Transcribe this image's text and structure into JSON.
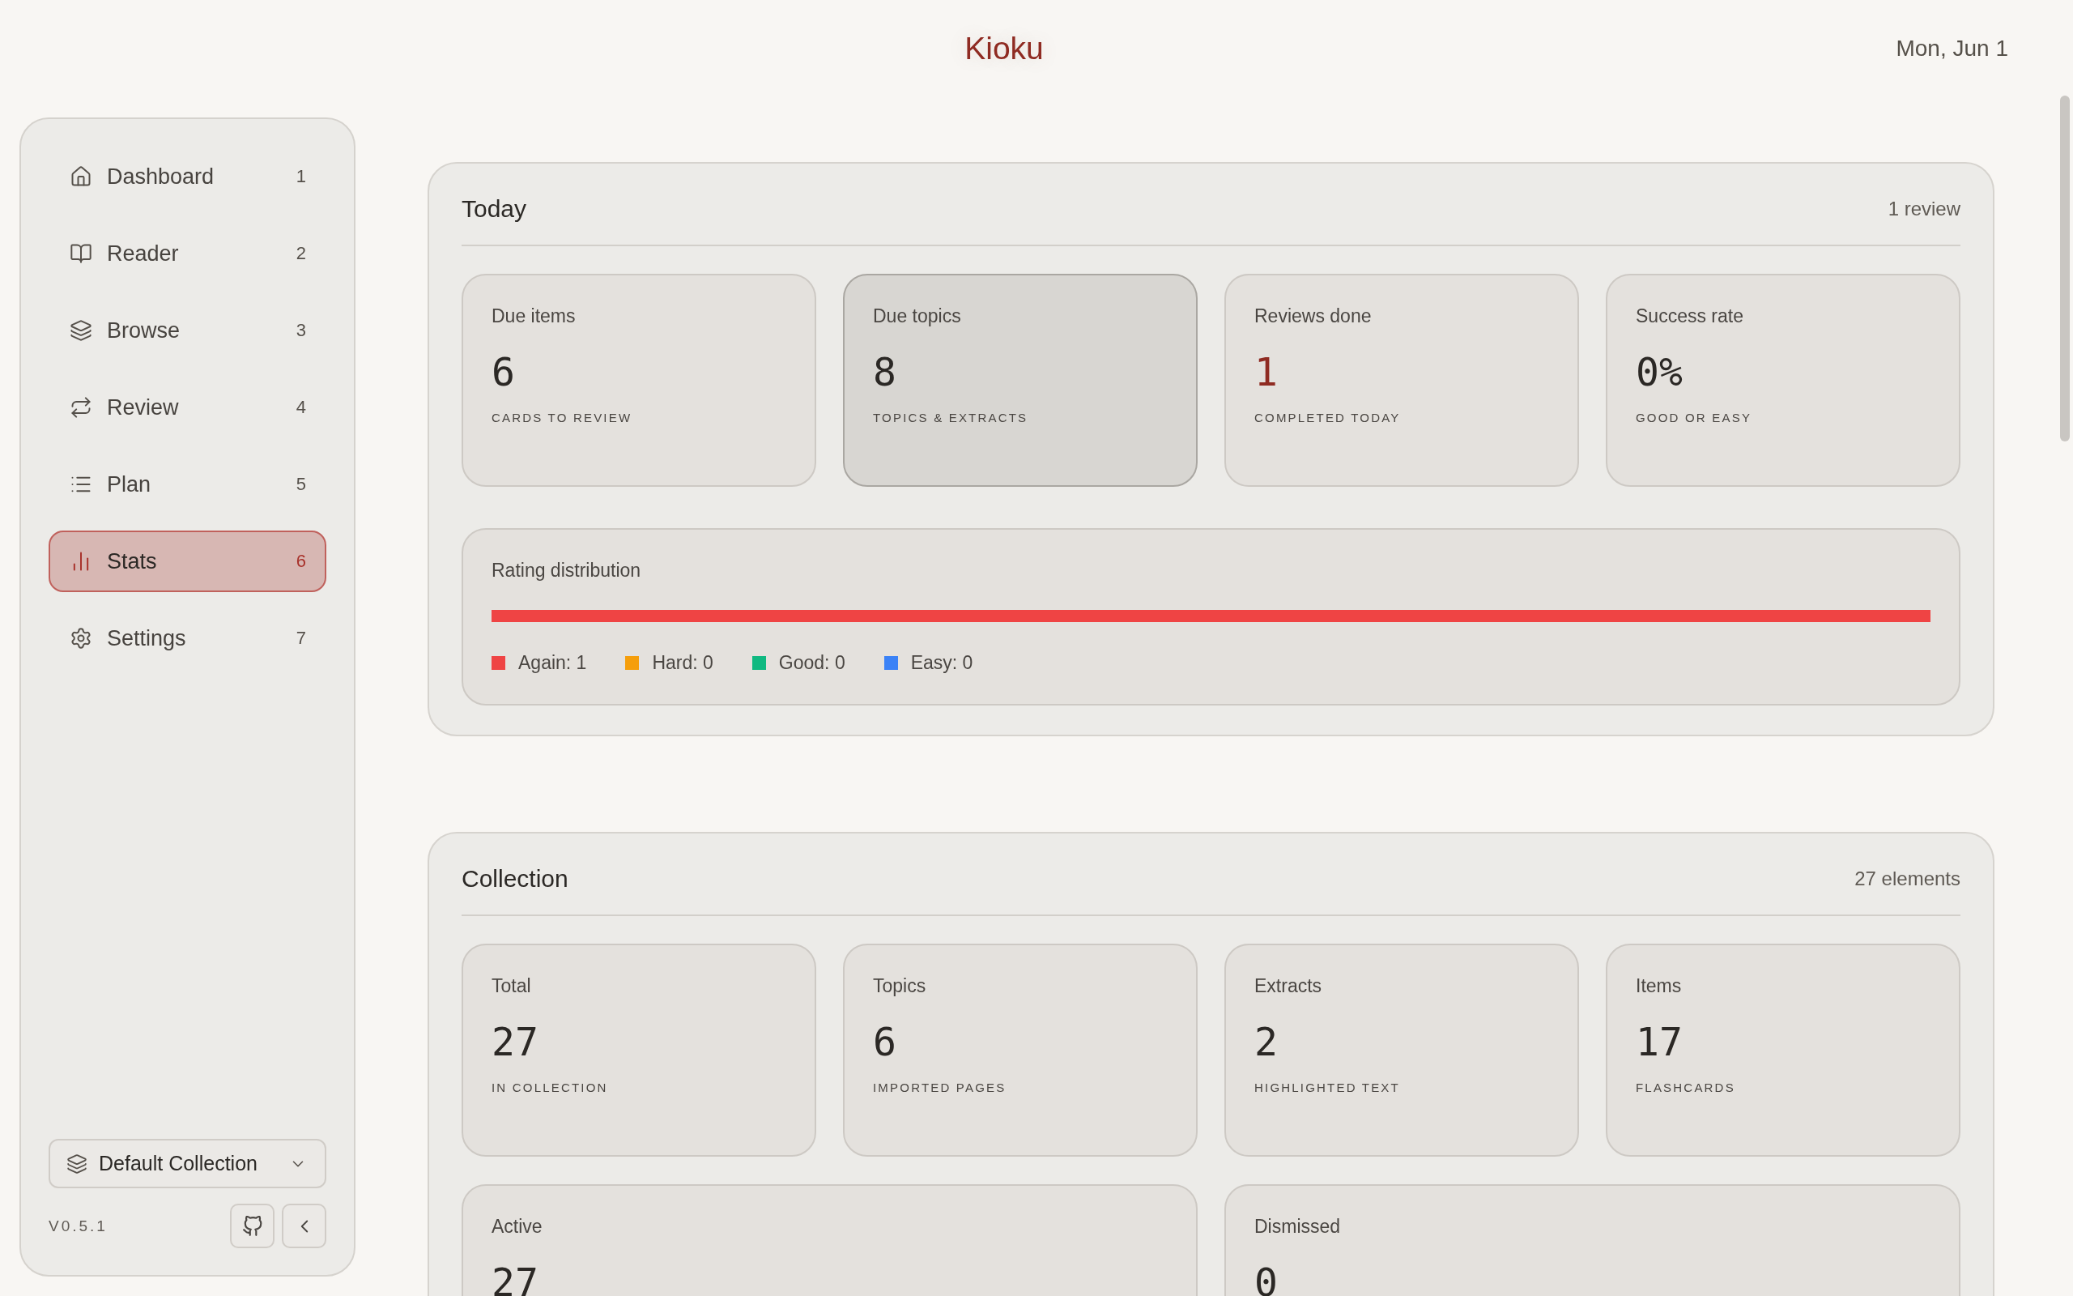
{
  "header": {
    "title": "Kioku",
    "date": "Mon, Jun 1"
  },
  "sidebar": {
    "items": [
      {
        "label": "Dashboard",
        "shortcut": "1",
        "selected": false
      },
      {
        "label": "Reader",
        "shortcut": "2",
        "selected": false
      },
      {
        "label": "Browse",
        "shortcut": "3",
        "selected": false
      },
      {
        "label": "Review",
        "shortcut": "4",
        "selected": false
      },
      {
        "label": "Plan",
        "shortcut": "5",
        "selected": false
      },
      {
        "label": "Stats",
        "shortcut": "6",
        "selected": true
      },
      {
        "label": "Settings",
        "shortcut": "7",
        "selected": false
      }
    ],
    "collection_select": {
      "value": "Default Collection"
    },
    "version": "V0.5.1"
  },
  "today": {
    "title": "Today",
    "summary": "1 review",
    "cards": [
      {
        "label": "Due items",
        "value": "6",
        "caption": "CARDS TO REVIEW",
        "highlighted": false,
        "accent": false
      },
      {
        "label": "Due topics",
        "value": "8",
        "caption": "TOPICS & EXTRACTS",
        "highlighted": true,
        "accent": false
      },
      {
        "label": "Reviews done",
        "value": "1",
        "caption": "COMPLETED TODAY",
        "highlighted": false,
        "accent": true
      },
      {
        "label": "Success rate",
        "value": "0%",
        "caption": "GOOD OR EASY",
        "highlighted": false,
        "accent": false
      }
    ],
    "rating_distribution": {
      "title": "Rating distribution",
      "bar": {
        "level": 1
      },
      "ratings": [
        {
          "label": "Again: 1",
          "color": "#ef4444"
        },
        {
          "label": "Hard: 0",
          "color": "#f59e0b"
        },
        {
          "label": "Good: 0",
          "color": "#10b981"
        },
        {
          "label": "Easy: 0",
          "color": "#3b82f6"
        }
      ]
    }
  },
  "collection": {
    "title": "Collection",
    "summary": "27 elements",
    "cards": [
      {
        "label": "Total",
        "value": "27",
        "caption": "IN COLLECTION",
        "highlighted": false,
        "accent": false
      },
      {
        "label": "Topics",
        "value": "6",
        "caption": "IMPORTED PAGES",
        "highlighted": false,
        "accent": false
      },
      {
        "label": "Extracts",
        "value": "2",
        "caption": "HIGHLIGHTED TEXT",
        "highlighted": false,
        "accent": false
      },
      {
        "label": "Items",
        "value": "17",
        "caption": "FLASHCARDS",
        "highlighted": false,
        "accent": false
      }
    ],
    "wide_cards": [
      {
        "label": "Active",
        "value": "27",
        "highlighted": false,
        "accent": false
      },
      {
        "label": "Dismissed",
        "value": "0",
        "highlighted": false,
        "accent": false
      }
    ]
  }
}
